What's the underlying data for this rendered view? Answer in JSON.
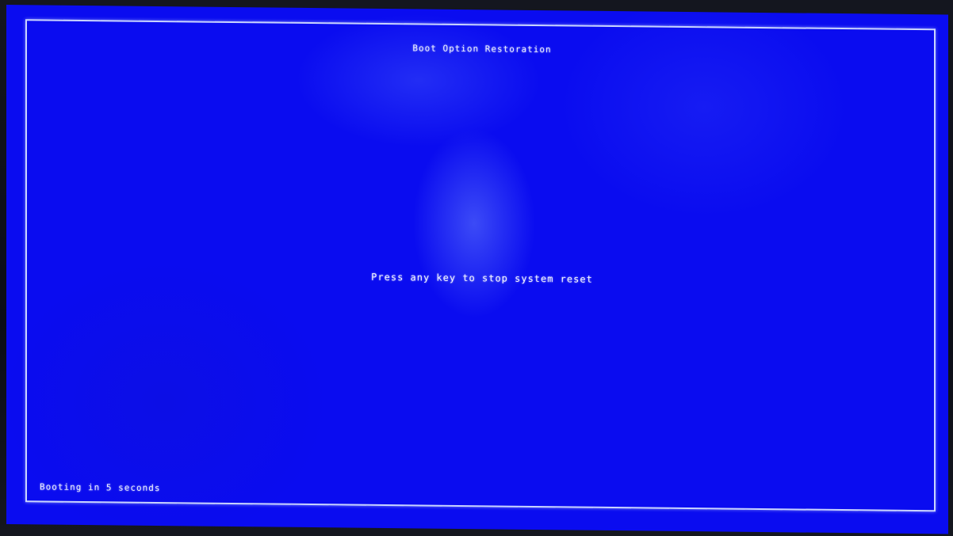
{
  "screen": {
    "title": "Boot Option Restoration",
    "message": "Press any key to stop system reset",
    "footer": "Booting in 5 seconds"
  },
  "colors": {
    "background": "#0a0cf0",
    "text": "#e8ecff",
    "border": "#c9d4ff"
  }
}
